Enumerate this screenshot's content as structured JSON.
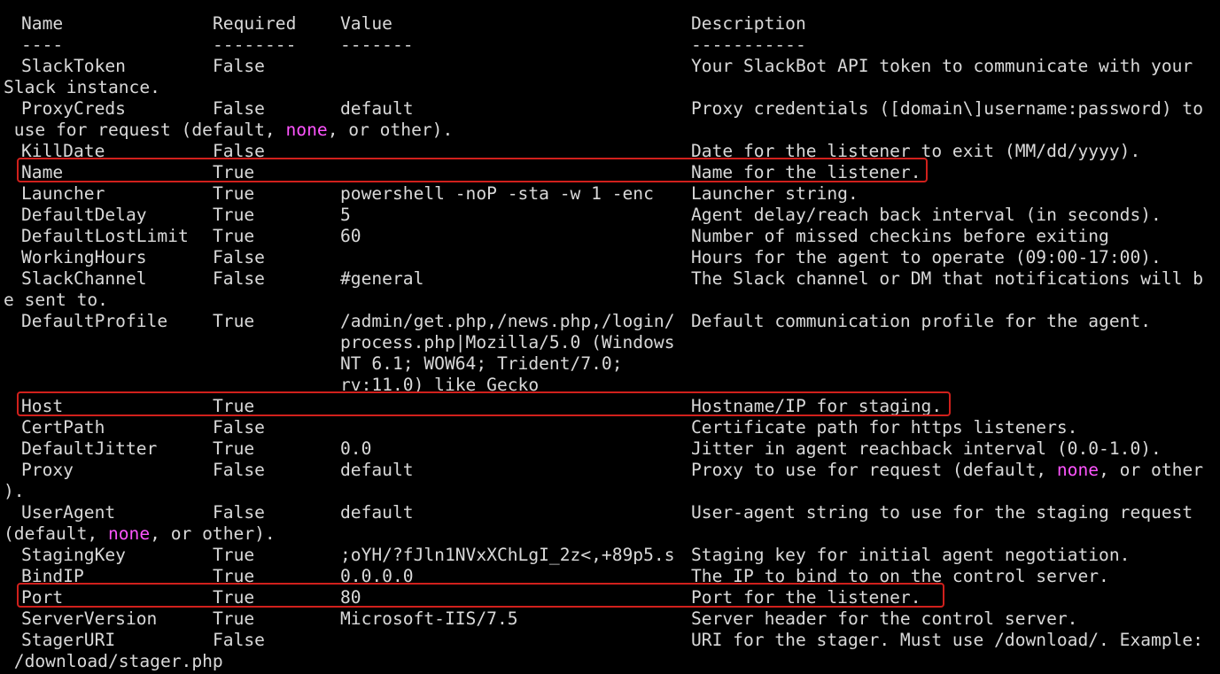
{
  "header": {
    "name": "Name",
    "required": "Required",
    "value": "Value",
    "description": "Description"
  },
  "dashes": {
    "name": "----",
    "required": "--------",
    "value": "-------",
    "description": "-----------"
  },
  "rows": [
    {
      "name": "SlackToken",
      "required": "False",
      "value": "",
      "description": "Your SlackBot API token to communicate with your",
      "wrap": "Slack instance."
    },
    {
      "name": "ProxyCreds",
      "required": "False",
      "value": "default",
      "description": "Proxy credentials ([domain\\]username:password) to",
      "wrap_pre": " use for request (default, ",
      "wrap_hl": "none",
      "wrap_post": ", or other)."
    },
    {
      "name": "KillDate",
      "required": "False",
      "value": "",
      "description": "Date for the listener to exit (MM/dd/yyyy)."
    },
    {
      "name": "Name",
      "required": "True",
      "value": "",
      "description": "Name for the listener."
    },
    {
      "name": "Launcher",
      "required": "True",
      "value": "powershell -noP -sta -w 1 -enc",
      "description": "Launcher string."
    },
    {
      "name": "DefaultDelay",
      "required": "True",
      "value": "5",
      "description": "Agent delay/reach back interval (in seconds)."
    },
    {
      "name": "DefaultLostLimit",
      "required": "True",
      "value": "60",
      "description": "Number of missed checkins before exiting"
    },
    {
      "name": "WorkingHours",
      "required": "False",
      "value": "",
      "description": "Hours for the agent to operate (09:00-17:00)."
    },
    {
      "name": "SlackChannel",
      "required": "False",
      "value": "#general",
      "description": "The Slack channel or DM that notifications will b",
      "wrap": "e sent to."
    },
    {
      "name": "DefaultProfile",
      "required": "True",
      "value": "/admin/get.php,/news.php,/login/",
      "description": "Default communication profile for the agent.",
      "value_wrap": [
        "process.php|Mozilla/5.0 (Windows",
        "NT 6.1; WOW64; Trident/7.0;",
        "rv:11.0) like Gecko"
      ]
    },
    {
      "name": "Host",
      "required": "True",
      "value": "",
      "description": "Hostname/IP for staging."
    },
    {
      "name": "CertPath",
      "required": "False",
      "value": "",
      "description": "Certificate path for https listeners."
    },
    {
      "name": "DefaultJitter",
      "required": "True",
      "value": "0.0",
      "description": "Jitter in agent reachback interval (0.0-1.0)."
    },
    {
      "name": "Proxy",
      "required": "False",
      "value": "default",
      "description_pre": "Proxy to use for request (default, ",
      "description_hl": "none",
      "description_post": ", or other",
      "wrap": ")."
    },
    {
      "name": "UserAgent",
      "required": "False",
      "value": "default",
      "description": "User-agent string to use for the staging request",
      "wrap_pre": "(default, ",
      "wrap_hl": "none",
      "wrap_post": ", or other)."
    },
    {
      "name": "StagingKey",
      "required": "True",
      "value": ";oYH/?fJln1NVxXChLgI_2z<,+89p5.s",
      "description": "Staging key for initial agent negotiation."
    },
    {
      "name": "BindIP",
      "required": "True",
      "value": "0.0.0.0",
      "description": "The IP to bind to on the control server."
    },
    {
      "name": "Port",
      "required": "True",
      "value": "80",
      "description": "Port for the listener."
    },
    {
      "name": "ServerVersion",
      "required": "True",
      "value": "Microsoft-IIS/7.5",
      "description": "Server header for the control server."
    },
    {
      "name": "StagerURI",
      "required": "False",
      "value": "",
      "description": "URI for the stager. Must use /download/. Example:",
      "wrap": " /download/stager.php"
    }
  ],
  "colors": {
    "background": "#000000",
    "text": "#d9d9d9",
    "highlight": "#ff55ff",
    "annotation_box": "#d0201c"
  }
}
